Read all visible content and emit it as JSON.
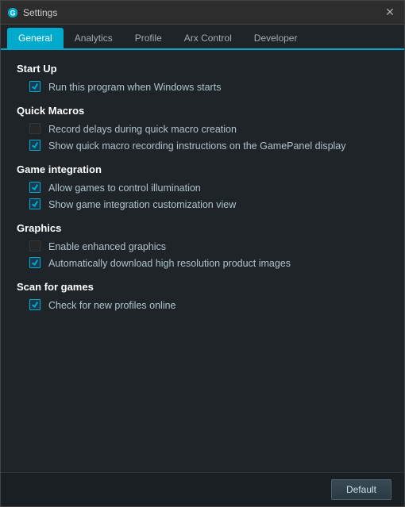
{
  "window": {
    "title": "Settings",
    "close_label": "✕"
  },
  "tabs": [
    {
      "id": "general",
      "label": "General",
      "active": true
    },
    {
      "id": "analytics",
      "label": "Analytics",
      "active": false
    },
    {
      "id": "profile",
      "label": "Profile",
      "active": false
    },
    {
      "id": "arx-control",
      "label": "Arx Control",
      "active": false
    },
    {
      "id": "developer",
      "label": "Developer",
      "active": false
    }
  ],
  "sections": [
    {
      "id": "startup",
      "title": "Start Up",
      "items": [
        {
          "id": "run-on-startup",
          "label": "Run this program when Windows starts",
          "checked": true,
          "disabled": false
        }
      ]
    },
    {
      "id": "quick-macros",
      "title": "Quick Macros",
      "items": [
        {
          "id": "record-delays",
          "label": "Record delays during quick macro creation",
          "checked": false,
          "disabled": true
        },
        {
          "id": "show-recording-instructions",
          "label": "Show quick macro recording instructions on the GamePanel display",
          "checked": true,
          "disabled": false
        }
      ]
    },
    {
      "id": "game-integration",
      "title": "Game integration",
      "items": [
        {
          "id": "allow-illumination",
          "label": "Allow games to control illumination",
          "checked": true,
          "disabled": false
        },
        {
          "id": "show-customization",
          "label": "Show game integration customization view",
          "checked": true,
          "disabled": false
        }
      ]
    },
    {
      "id": "graphics",
      "title": "Graphics",
      "items": [
        {
          "id": "enhanced-graphics",
          "label": "Enable enhanced graphics",
          "checked": false,
          "disabled": true
        },
        {
          "id": "auto-download-images",
          "label": "Automatically download high resolution product images",
          "checked": true,
          "disabled": false
        }
      ]
    },
    {
      "id": "scan-for-games",
      "title": "Scan for games",
      "items": [
        {
          "id": "check-profiles-online",
          "label": "Check for new profiles online",
          "checked": true,
          "disabled": false
        }
      ]
    }
  ],
  "footer": {
    "default_button": "Default"
  }
}
